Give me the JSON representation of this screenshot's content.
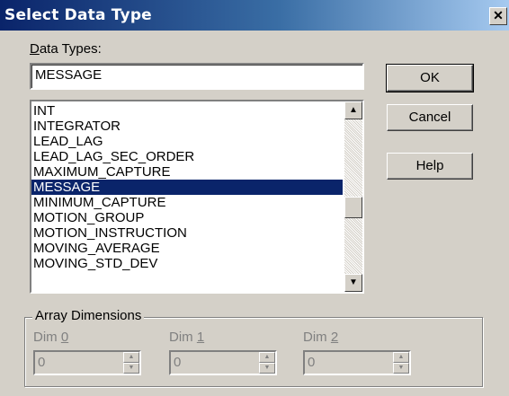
{
  "window": {
    "title": "Select Data Type",
    "close_glyph": "✕"
  },
  "data_types": {
    "label_prefix": "",
    "label_mnemonic": "D",
    "label_rest": "ata Types:",
    "value": "MESSAGE"
  },
  "buttons": {
    "ok": "OK",
    "cancel": "Cancel",
    "help": "Help"
  },
  "type_list": {
    "items": [
      "INT",
      "INTEGRATOR",
      "LEAD_LAG",
      "LEAD_LAG_SEC_ORDER",
      "MAXIMUM_CAPTURE",
      "MESSAGE",
      "MINIMUM_CAPTURE",
      "MOTION_GROUP",
      "MOTION_INSTRUCTION",
      "MOVING_AVERAGE",
      "MOVING_STD_DEV"
    ],
    "selected": "MESSAGE",
    "scroll_up_icon": "arrow-up-icon",
    "scroll_down_icon": "arrow-down-icon"
  },
  "array_dimensions": {
    "title": "Array Dimensions",
    "dim0": {
      "prefix": "Dim ",
      "mnemonic": "0",
      "value": "0"
    },
    "dim1": {
      "prefix": "Dim ",
      "mnemonic": "1",
      "value": "0"
    },
    "dim2": {
      "prefix": "Dim ",
      "mnemonic": "2",
      "value": "0"
    }
  },
  "colors": {
    "title_bar": "#0a246a",
    "dialog_face": "#d4d0c8",
    "selection": "#0a246a",
    "disabled_text": "#808080"
  }
}
